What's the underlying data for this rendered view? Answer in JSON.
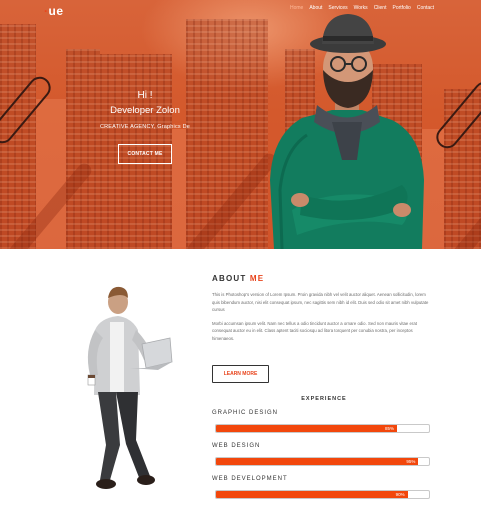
{
  "brand": {
    "logo_dot": "·",
    "logo_text": "ue",
    "accent_color": "#e8441c"
  },
  "nav": [
    "Home",
    "About",
    "Services",
    "Works",
    "Client",
    "Portfolio",
    "Contact"
  ],
  "hero": {
    "greeting": "Hi !",
    "name": "Developer Zolon",
    "subtitle": "CREATIVE AGENCY, Graphics De",
    "button": "CONTACT ME"
  },
  "about": {
    "title_prefix": "ABOUT",
    "title_accent": "ME",
    "paragraph_1": "This is Photoshop's version of Lorem Ipsum. Proin gravida nibh vel velit auctor aliquet. Aenean sollicitudin, lorem quis bibendum auctor, nisi elit consequat ipsum, nec sagittis sem nibh id elit. Duis sed odio sit amet nibh vulputate cursus",
    "paragraph_2": "Morbi accumsan ipsum velit. Nam nec tellus a odio tincidunt auctor a ornare odio. Sed non mauris vitae erat consequat auctor eu in elit. Class aptent taciti sociosqu ad litora torquent per conubia nostra, per inceptos himenaeos.",
    "button": "LEARN MORE"
  },
  "experience": {
    "title": "EXPERIENCE",
    "skills": [
      {
        "label": "GRAPHIC DESIGN",
        "percent": 85,
        "percent_text": "85%"
      },
      {
        "label": "WEB DESIGN",
        "percent": 95,
        "percent_text": "95%"
      },
      {
        "label": "WEB DEVELOPMENT",
        "percent": 90,
        "percent_text": "90%"
      }
    ]
  }
}
